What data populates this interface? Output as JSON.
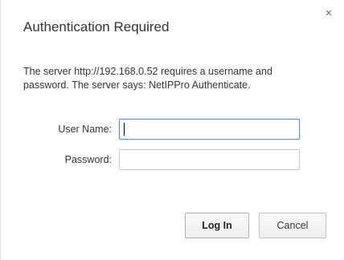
{
  "dialog": {
    "title": "Authentication Required",
    "message": "The server http://192.168.0.52 requires a username and password. The server says: NetIPPro Authenticate.",
    "close_glyph": "×"
  },
  "form": {
    "username_label": "User Name:",
    "username_value": "",
    "password_label": "Password:",
    "password_value": ""
  },
  "buttons": {
    "login_label": "Log In",
    "cancel_label": "Cancel"
  },
  "colors": {
    "focus_border": "#4d90fe",
    "text": "#333333"
  },
  "icons": {
    "close": "close-icon"
  }
}
